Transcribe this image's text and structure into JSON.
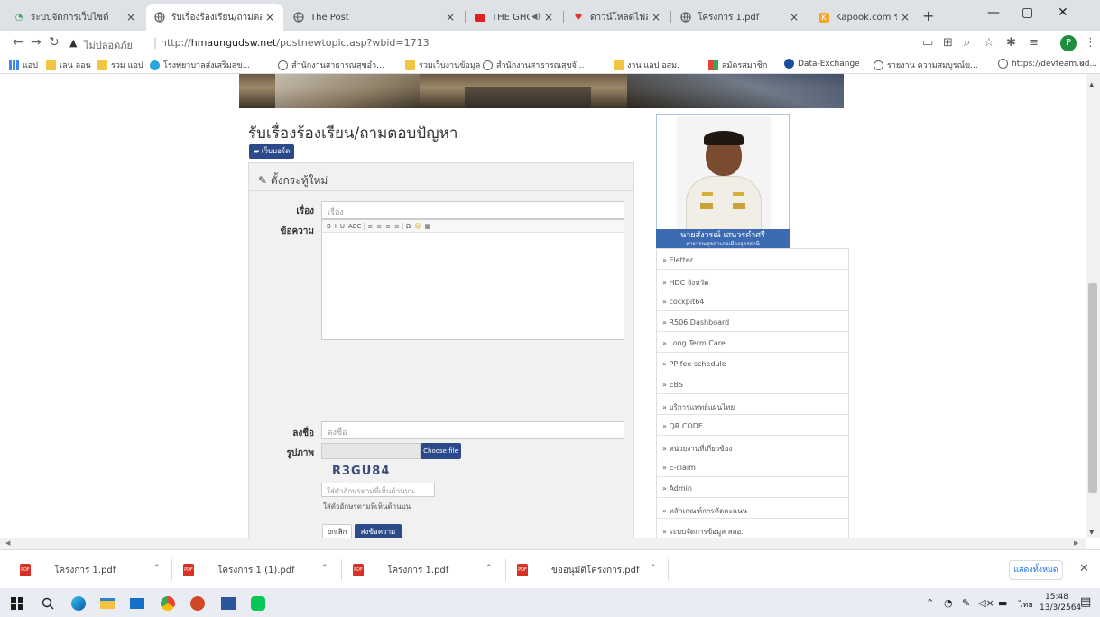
{
  "browser": {
    "tabs": [
      {
        "title": "ระบบจัดการเว็บไซต์",
        "favicon": "site-icon",
        "active": false
      },
      {
        "title": "รับเรื่องร้องเรียน/ถามตอบปั",
        "favicon": "globe-icon",
        "active": true
      },
      {
        "title": "The Post",
        "favicon": "globe-icon",
        "active": false
      },
      {
        "title": "THE GHOST RADIO",
        "favicon": "youtube-icon",
        "active": false,
        "extra": "◀)"
      },
      {
        "title": "ดาวน์โหลดไฟล์ | iLovePDF",
        "favicon": "heart-icon",
        "active": false
      },
      {
        "title": "โครงการ 1.pdf",
        "favicon": "globe-icon",
        "active": false
      },
      {
        "title": "Kapook.com รวม ข่าว ฯ",
        "favicon": "kapook-icon",
        "active": false
      }
    ],
    "new_tab": "+",
    "window_controls": {
      "minimize": "—",
      "maximize": "▢",
      "close": "✕"
    },
    "address": {
      "insecure_label": "ไม่ปลอดภัย",
      "url_prefix": "http://",
      "url_host": "hmaungudsw.net",
      "url_path": "/postnewtopic.asp?wbid=1713"
    },
    "profile_initial": "P",
    "bookmarks": [
      {
        "label": "แอป",
        "icon": "apps-icon"
      },
      {
        "label": "เลน ลอน",
        "icon": "folder-icon"
      },
      {
        "label": "รวม แอป",
        "icon": "folder-icon"
      },
      {
        "label": "โรงพยาบาลส่งเสริมสุข...",
        "icon": "hospital-icon"
      },
      {
        "label": "สำนักงานสาธารณสุขอำ...",
        "icon": "globe-icon"
      },
      {
        "label": "รวมเว็บงานข้อมูล",
        "icon": "folder-icon"
      },
      {
        "label": "สำนักงานสาธารณสุขจั...",
        "icon": "globe-icon"
      },
      {
        "label": "งาน แอป อสม.",
        "icon": "folder-icon"
      },
      {
        "label": "สมัครสมาชิก",
        "icon": "members-icon"
      },
      {
        "label": "Data-Exchange",
        "icon": "data-icon"
      },
      {
        "label": "รายงาน ความสมบูรณ์ข...",
        "icon": "globe-icon"
      },
      {
        "label": "https://devteam.ud...",
        "icon": "globe-icon"
      }
    ],
    "bookmarks_more": "»"
  },
  "page": {
    "title": "รับเรื่องร้องเรียน/ถามตอบปัญหา",
    "chat_button": "เว็บบอร์ด",
    "form": {
      "heading": "ตั้งกระทู้ใหม่",
      "subject_label": "เรื่อง",
      "subject_placeholder": "เรื่อง",
      "message_label": "ข้อความ",
      "editor_tools": [
        "B",
        "I",
        "U",
        "ABC",
        "≡",
        "≡",
        "≡",
        "≡",
        "Ω",
        "☺",
        "▦",
        "···"
      ],
      "name_label": "ลงชื่อ",
      "name_placeholder": "ลงชื่อ",
      "image_label": "รูปภาพ",
      "file_button": "Choose file",
      "captcha_code": "R3GU84",
      "captcha_placeholder": "ใส่ตัวอักษรตามที่เห็นด้านบน",
      "captcha_hint": "ใส่ตัวอักษรตามที่เห็นด้านบน",
      "cancel_button": "ยกเลิก",
      "submit_button": "ส่งข้อความ"
    },
    "profile_card": {
      "name": "นายสังวรณ์  เสนวรคำศรี",
      "position": "สาธารณสุขอำเภอเมืองอุดรธานี"
    },
    "links": [
      "» Eletter",
      "» HDC จังหวัด",
      "» cockpit64",
      "» R506 Dashboard",
      "» Long Term Care",
      "» PP fee schedule",
      "» EBS",
      "» บริการแพทย์แผนไทย",
      "» QR CODE",
      "» หน่วยงานที่เกี่ยวข้อง",
      "» E-claim",
      "» Admin",
      "» หลักเกณฑ์การคัดคะแนน",
      "» ระบบจัดการข้อมูล สสอ."
    ]
  },
  "downloads": {
    "items": [
      "โครงการ 1.pdf",
      "โครงการ 1 (1).pdf",
      "โครงการ 1.pdf",
      "ขออนุมัติโครงการ.pdf"
    ],
    "show_all": "แสดงทั้งหมด",
    "close": "✕"
  },
  "taskbar": {
    "language": "ไทย",
    "time": "15:48",
    "date": "13/3/2564"
  },
  "colors": {
    "accent_blue": "#2a4a8a",
    "name_plate": "#3d6bb2",
    "tab_strip": "#dee1e6"
  }
}
